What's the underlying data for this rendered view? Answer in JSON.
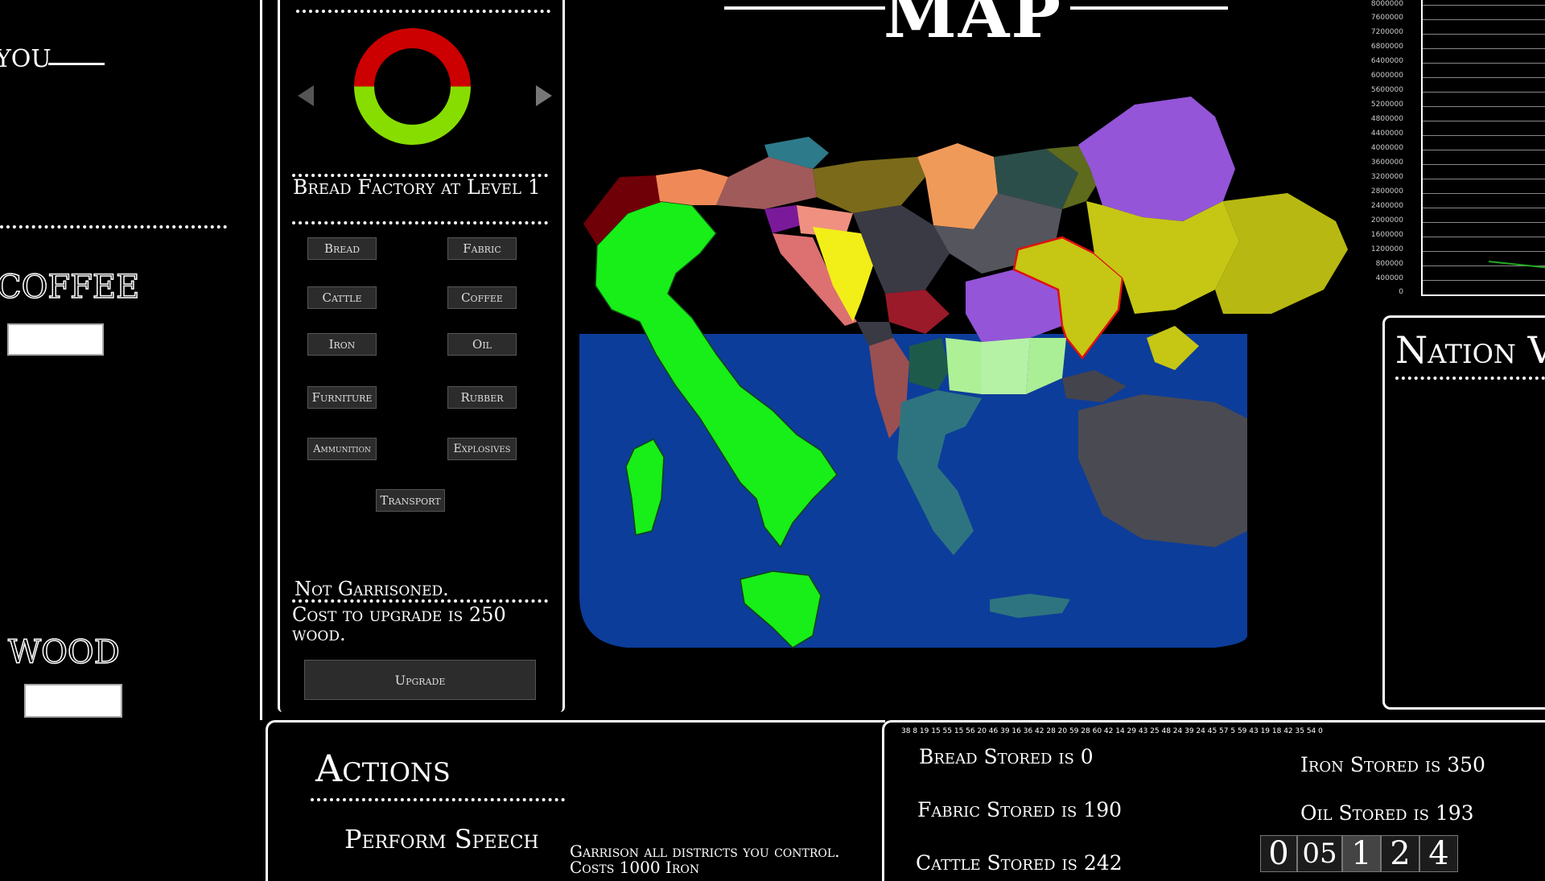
{
  "left_panel": {
    "you_label": "YOU",
    "coffee_label": "COFFEE",
    "wood_label": "WOOD"
  },
  "factory_panel": {
    "title": "Bread Factory at Level 1",
    "donut": {
      "red_fraction": 0.5,
      "green_fraction": 0.5,
      "red_color": "#cc0000",
      "green_color": "#88dd00"
    },
    "buttons": [
      "Bread",
      "Fabric",
      "Cattle",
      "Coffee",
      "Iron",
      "Oil",
      "Furniture",
      "Rubber",
      "Ammunition",
      "Explosives",
      "Transport"
    ],
    "garrison_status": "Not Garrisoned.",
    "upgrade_cost": "Cost to upgrade is 250 wood.",
    "upgrade_button": "Upgrade"
  },
  "map_title": "MAP",
  "nation_panel": {
    "title": "Nation V"
  },
  "graph": {
    "y_ticks": [
      "8000000",
      "7600000",
      "7200000",
      "6800000",
      "6400000",
      "6000000",
      "5600000",
      "5200000",
      "4800000",
      "4400000",
      "4000000",
      "3600000",
      "3200000",
      "2800000",
      "2400000",
      "2000000",
      "1600000",
      "1200000",
      "800000",
      "400000",
      "0"
    ],
    "line_color": "#22aa22"
  },
  "actions": {
    "title": "Actions",
    "perform_speech": "Perform Speech",
    "garrison_action": "Garrison all districts you control.",
    "garrison_cost": "Costs 1000 Iron"
  },
  "storage": {
    "ticker": "38 8 19 15 55 15 56 20 46 39 16 36 42 28 20 59 28 60 42 14 29 43 25 48 24 39 24 45 57 5 59 43 19 18 42 35 54 0",
    "bread": "Bread Stored is 0",
    "fabric": "Fabric Stored is 190",
    "cattle": "Cattle Stored is 242",
    "iron": "Iron Stored is 350",
    "oil": "Oil Stored is 193"
  },
  "counter": {
    "digits": [
      "0",
      "05",
      "1",
      "2",
      "4"
    ]
  }
}
